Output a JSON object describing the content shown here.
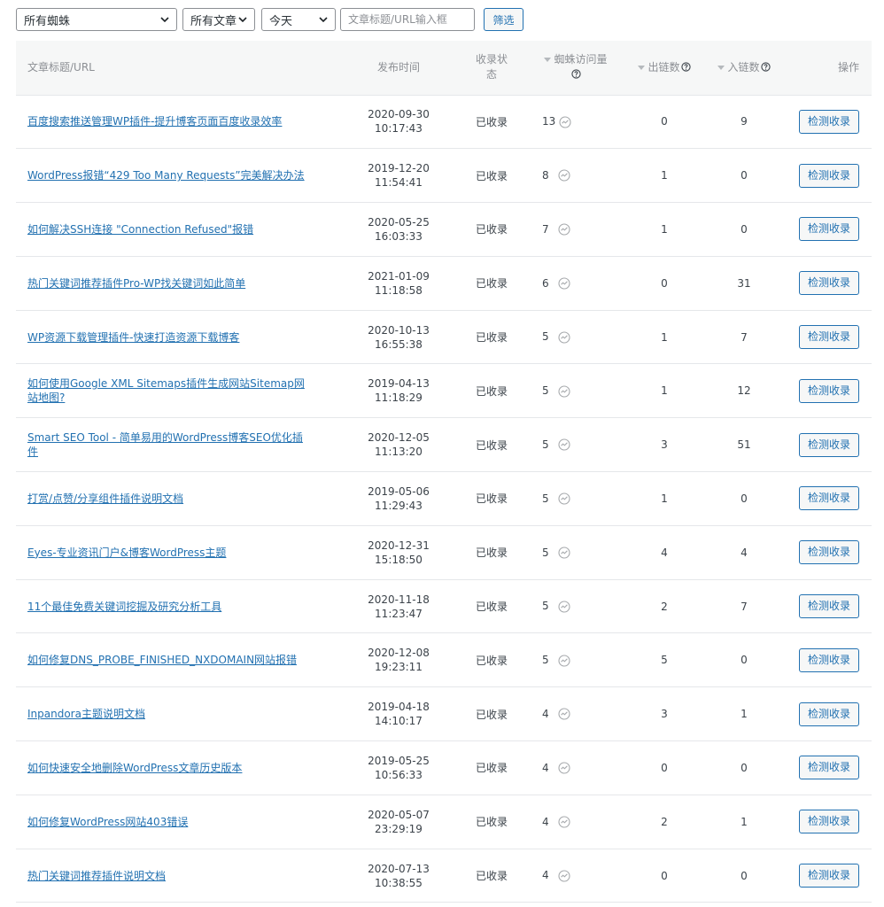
{
  "filters": {
    "spider_select": "所有蜘蛛",
    "article_select": "所有文章",
    "date_select": "今天",
    "search_placeholder": "文章标题/URL输入框",
    "filter_button": "筛选"
  },
  "table": {
    "columns": {
      "title": "文章标题/URL",
      "date": "发布时间",
      "status_line1": "收录状",
      "status_line2": "态",
      "visits": "蜘蛛访问量",
      "outlinks": "出链数",
      "inlinks": "入链数",
      "action": "操作"
    },
    "rows": [
      {
        "title": "百度搜索推送管理WP插件-提升博客页面百度收录效率",
        "date": "2020-09-30",
        "time": "10:17:43",
        "status": "已收录",
        "visits": "13",
        "out": "0",
        "in": "9",
        "action": "检测收录"
      },
      {
        "title": "WordPress报错“429 Too Many Requests”完美解决办法",
        "date": "2019-12-20",
        "time": "11:54:41",
        "status": "已收录",
        "visits": "8",
        "out": "1",
        "in": "0",
        "action": "检测收录"
      },
      {
        "title": "如何解决SSH连接 \"Connection Refused\"报错",
        "date": "2020-05-25",
        "time": "16:03:33",
        "status": "已收录",
        "visits": "7",
        "out": "1",
        "in": "0",
        "action": "检测收录"
      },
      {
        "title": "热门关键词推荐插件Pro-WP找关键词如此简单",
        "date": "2021-01-09",
        "time": "11:18:58",
        "status": "已收录",
        "visits": "6",
        "out": "0",
        "in": "31",
        "action": "检测收录"
      },
      {
        "title": "WP资源下载管理插件-快速打造资源下载博客",
        "date": "2020-10-13",
        "time": "16:55:38",
        "status": "已收录",
        "visits": "5",
        "out": "1",
        "in": "7",
        "action": "检测收录"
      },
      {
        "title": "如何使用Google XML Sitemaps插件生成网站Sitemap网站地图?",
        "date": "2019-04-13",
        "time": "11:18:29",
        "status": "已收录",
        "visits": "5",
        "out": "1",
        "in": "12",
        "action": "检测收录"
      },
      {
        "title": "Smart SEO Tool - 简单易用的WordPress博客SEO优化插件",
        "date": "2020-12-05",
        "time": "11:13:20",
        "status": "已收录",
        "visits": "5",
        "out": "3",
        "in": "51",
        "action": "检测收录"
      },
      {
        "title": "打赏/点赞/分享组件插件说明文档",
        "date": "2019-05-06",
        "time": "11:29:43",
        "status": "已收录",
        "visits": "5",
        "out": "1",
        "in": "0",
        "action": "检测收录"
      },
      {
        "title": "Eyes-专业资讯门户&博客WordPress主题",
        "date": "2020-12-31",
        "time": "15:18:50",
        "status": "已收录",
        "visits": "5",
        "out": "4",
        "in": "4",
        "action": "检测收录"
      },
      {
        "title": "11个最佳免费关键词挖掘及研究分析工具",
        "date": "2020-11-18",
        "time": "11:23:47",
        "status": "已收录",
        "visits": "5",
        "out": "2",
        "in": "7",
        "action": "检测收录"
      },
      {
        "title": "如何修复DNS_PROBE_FINISHED_NXDOMAIN网站报错",
        "date": "2020-12-08",
        "time": "19:23:11",
        "status": "已收录",
        "visits": "5",
        "out": "5",
        "in": "0",
        "action": "检测收录"
      },
      {
        "title": "Inpandora主题说明文档",
        "date": "2019-04-18",
        "time": "14:10:17",
        "status": "已收录",
        "visits": "4",
        "out": "3",
        "in": "1",
        "action": "检测收录"
      },
      {
        "title": "如何快速安全地删除WordPress文章历史版本",
        "date": "2019-05-25",
        "time": "10:56:33",
        "status": "已收录",
        "visits": "4",
        "out": "0",
        "in": "0",
        "action": "检测收录"
      },
      {
        "title": "如何修复WordPress网站403错误",
        "date": "2020-05-07",
        "time": "23:29:19",
        "status": "已收录",
        "visits": "4",
        "out": "2",
        "in": "1",
        "action": "检测收录"
      },
      {
        "title": "热门关键词推荐插件说明文档",
        "date": "2020-07-13",
        "time": "10:38:55",
        "status": "已收录",
        "visits": "4",
        "out": "0",
        "in": "0",
        "action": "检测收录"
      }
    ]
  }
}
